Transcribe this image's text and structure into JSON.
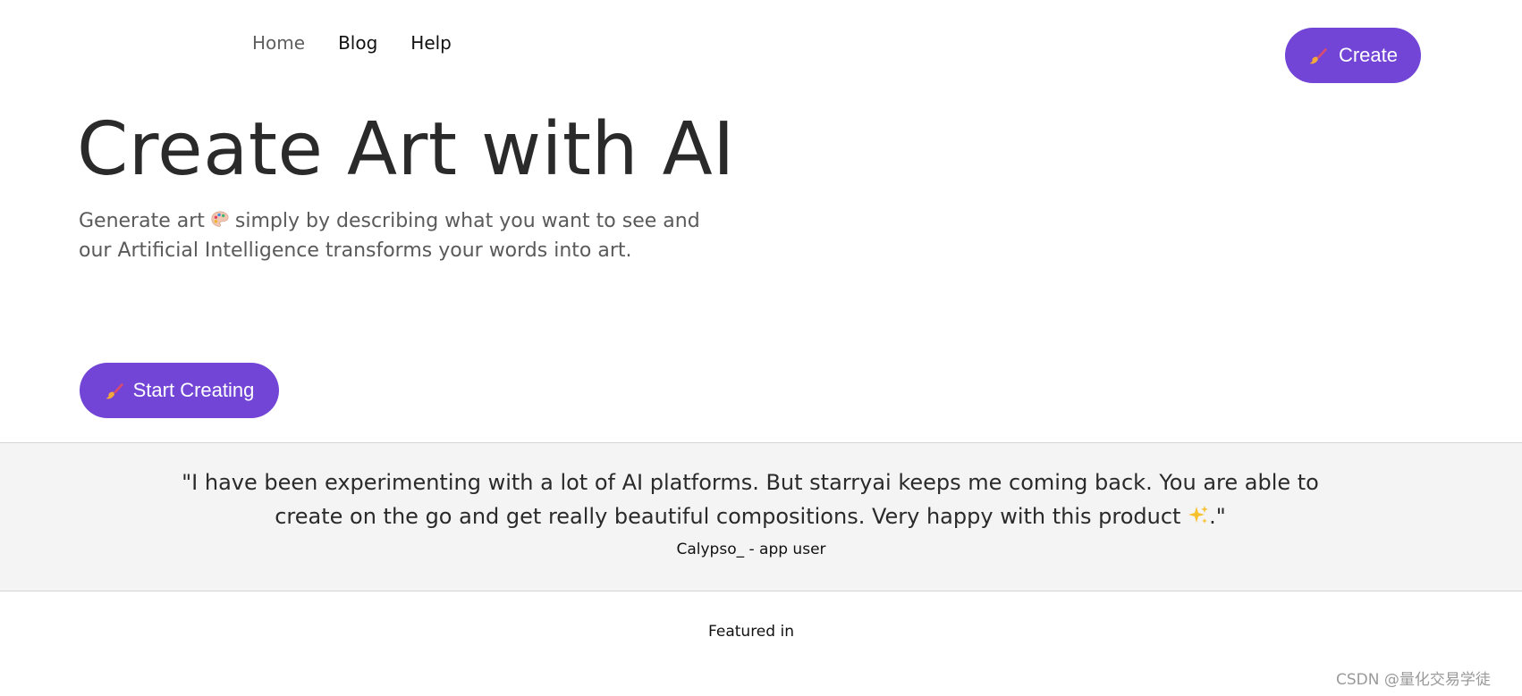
{
  "nav": {
    "items": [
      {
        "label": "Home",
        "active": true
      },
      {
        "label": "Blog",
        "active": false
      },
      {
        "label": "Help",
        "active": false
      }
    ],
    "create_label": "Create"
  },
  "hero": {
    "title": "Create Art with AI",
    "subtitle_part1": "Generate art",
    "subtitle_part2": "simply by describing what you want to see and our Artificial Intelligence transforms your words into art.",
    "start_label": "Start Creating"
  },
  "testimonial": {
    "quote_open": "\"I have been experimenting with a lot of AI platforms. But starryai keeps me coming back. You are able to create on the go and get really beautiful compositions. Very happy with this product ",
    "quote_close": ".\"",
    "author": "Calypso_ - app user"
  },
  "featured": {
    "label": "Featured in"
  },
  "watermark": {
    "text": "CSDN @量化交易学徒"
  },
  "icons": {
    "brush": "paintbrush-icon",
    "palette": "artist-palette-icon",
    "sparkles": "sparkles-icon"
  },
  "colors": {
    "accent": "#7245d6",
    "band": "#f4f4f4",
    "title": "#2a2a2a",
    "muted": "#5a5a5a"
  }
}
